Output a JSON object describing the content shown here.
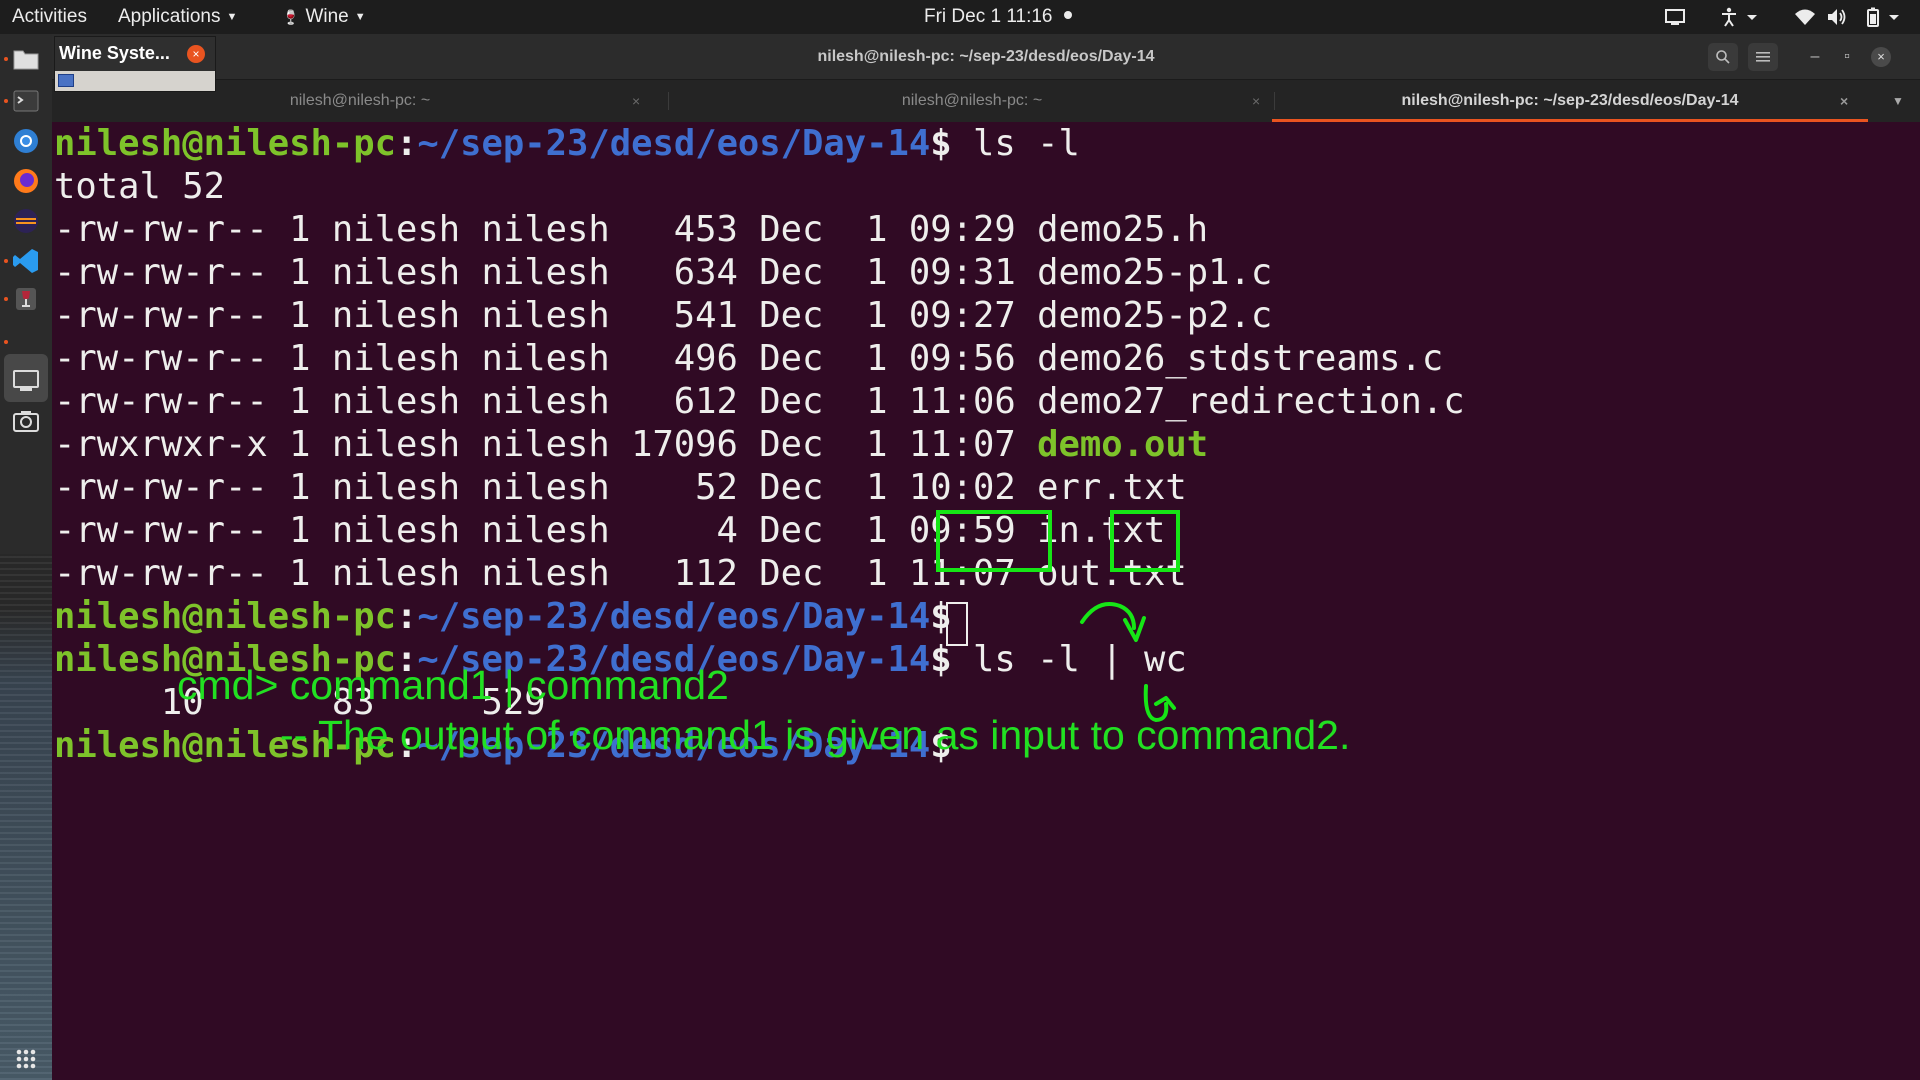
{
  "topbar": {
    "activities": "Activities",
    "applications": "Applications",
    "wine": "Wine",
    "clock": "Fri Dec 1  11:16"
  },
  "wine_popup": {
    "title": "Wine Syste...",
    "close": "×"
  },
  "window": {
    "title": "nilesh@nilesh-pc: ~/sep-23/desd/eos/Day-14",
    "tabs": [
      {
        "label": "nilesh@nilesh-pc: ~"
      },
      {
        "label": "nilesh@nilesh-pc: ~"
      },
      {
        "label": "nilesh@nilesh-pc: ~/sep-23/desd/eos/Day-14"
      }
    ],
    "close_glyph": "×",
    "min_glyph": "–",
    "max_glyph": "▫"
  },
  "terminal": {
    "prompt_user": "nilesh@nilesh-pc",
    "prompt_colon": ":",
    "prompt_path": "~/sep-23/desd/eos/Day-14",
    "prompt_sign": "$",
    "cmd1": " ls -l",
    "total": "total 52",
    "listing": [
      {
        "perm_prefix": "-rw-rw-r-- 1 nilesh nilesh   453 Dec  1 09:29 ",
        "name": "demo25.h"
      },
      {
        "perm_prefix": "-rw-rw-r-- 1 nilesh nilesh   634 Dec  1 09:31 ",
        "name": "demo25-p1.c"
      },
      {
        "perm_prefix": "-rw-rw-r-- 1 nilesh nilesh   541 Dec  1 09:27 ",
        "name": "demo25-p2.c"
      },
      {
        "perm_prefix": "-rw-rw-r-- 1 nilesh nilesh   496 Dec  1 09:56 ",
        "name": "demo26_stdstreams.c"
      },
      {
        "perm_prefix": "-rw-rw-r-- 1 nilesh nilesh   612 Dec  1 11:06 ",
        "name": "demo27_redirection.c"
      },
      {
        "perm_prefix": "-rwxrwxr-x 1 nilesh nilesh 17096 Dec  1 11:07 ",
        "name": "demo.out"
      },
      {
        "perm_prefix": "-rw-rw-r-- 1 nilesh nilesh    52 Dec  1 10:02 ",
        "name": "err.txt"
      },
      {
        "perm_prefix": "-rw-rw-r-- 1 nilesh nilesh     4 Dec  1 09:59 ",
        "name": "in.txt"
      },
      {
        "perm_prefix": "-rw-rw-r-- 1 nilesh nilesh   112 Dec  1 11:07 ",
        "name": "out.txt"
      }
    ],
    "cmd2": " ls -l | wc",
    "wc_output": "     10      83     529"
  },
  "annotations": {
    "line1": "cmd> command1 | command2",
    "line2": "-- The output of command1 is given as input to command2."
  },
  "colors": {
    "terminal_bg": "#300a24",
    "prompt_user": "#7ec32a",
    "prompt_path": "#3f6fd0",
    "annotation": "#16e616",
    "accent": "#e95420"
  }
}
